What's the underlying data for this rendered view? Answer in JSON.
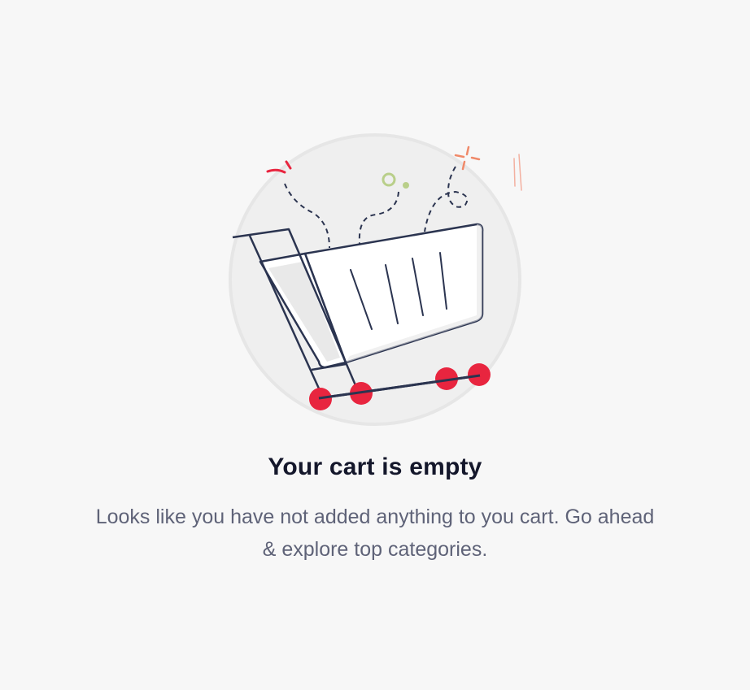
{
  "empty_state": {
    "title": "Your cart is empty",
    "description": "Looks like you have not added anything to you cart. Go ahead & explore top categories.",
    "illustration_icon": "shopping-cart-icon"
  },
  "colors": {
    "background": "#f7f7f7",
    "circle": "#efefef",
    "outline": "#2b3450",
    "wheel_red": "#e8253f",
    "accent_orange": "#f08a6a",
    "accent_green": "#b9cf8a",
    "title_text": "#14172b",
    "body_text": "#5f6378"
  }
}
